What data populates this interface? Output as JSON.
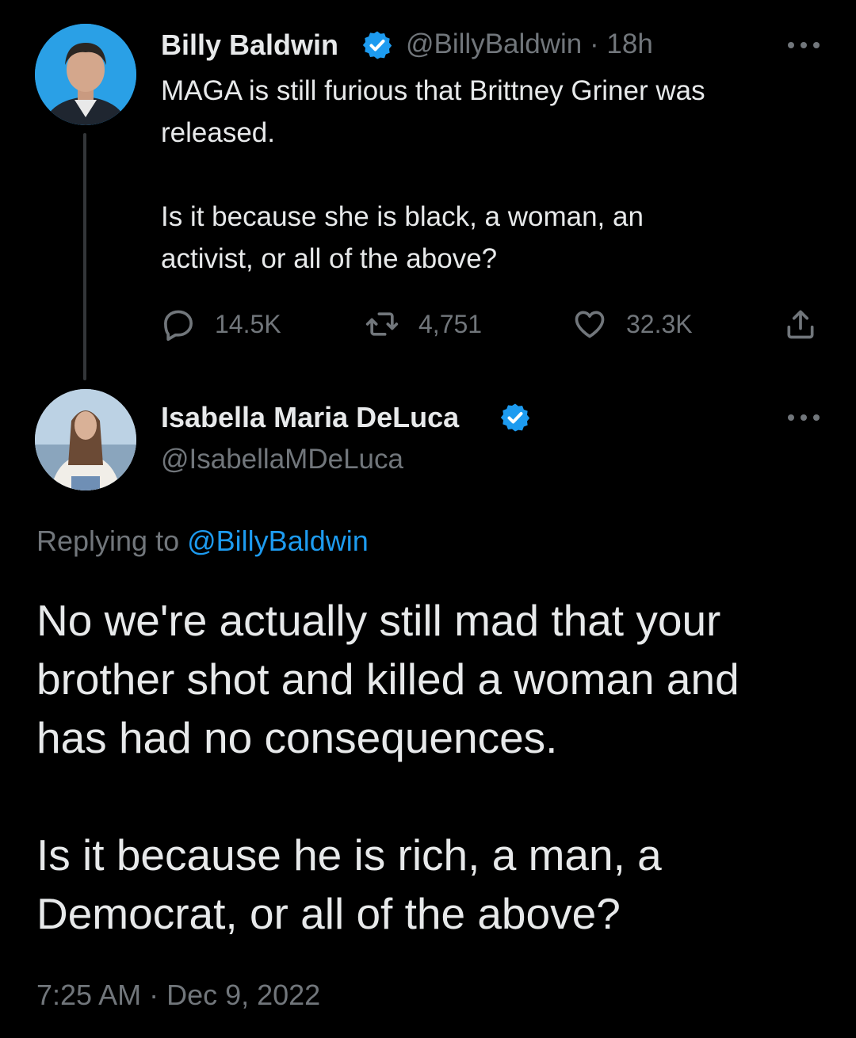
{
  "tweet": {
    "author_name": "Billy Baldwin",
    "handle": "@BillyBaldwin",
    "separator": "·",
    "time": "18h",
    "text": "MAGA is still furious that Brittney Griner was\nreleased.\n\nIs it because she is black, a woman, an\nactivist, or all of the above?",
    "replies": "14.5K",
    "retweets": "4,751",
    "likes": "32.3K"
  },
  "reply": {
    "author_name": "Isabella Maria DeLuca",
    "handle": "@IsabellaMDeLuca",
    "replying_prefix": "Replying to",
    "replying_handle": "@BillyBaldwin",
    "text": "No we're actually still mad that your\nbrother shot and killed a woman and\nhas had no consequences.\n\nIs it because he is rich, a man, a\nDemocrat, or all of the above?",
    "timestamp": "7:25 AM · Dec 9, 2022"
  },
  "colors": {
    "background": "#000000",
    "primary_text": "#e7e9ea",
    "secondary_text": "#71767b",
    "accent": "#1d9bf0"
  },
  "icons": [
    "verified-badge-icon",
    "more-icon",
    "reply-icon",
    "retweet-icon",
    "like-icon",
    "share-icon"
  ]
}
